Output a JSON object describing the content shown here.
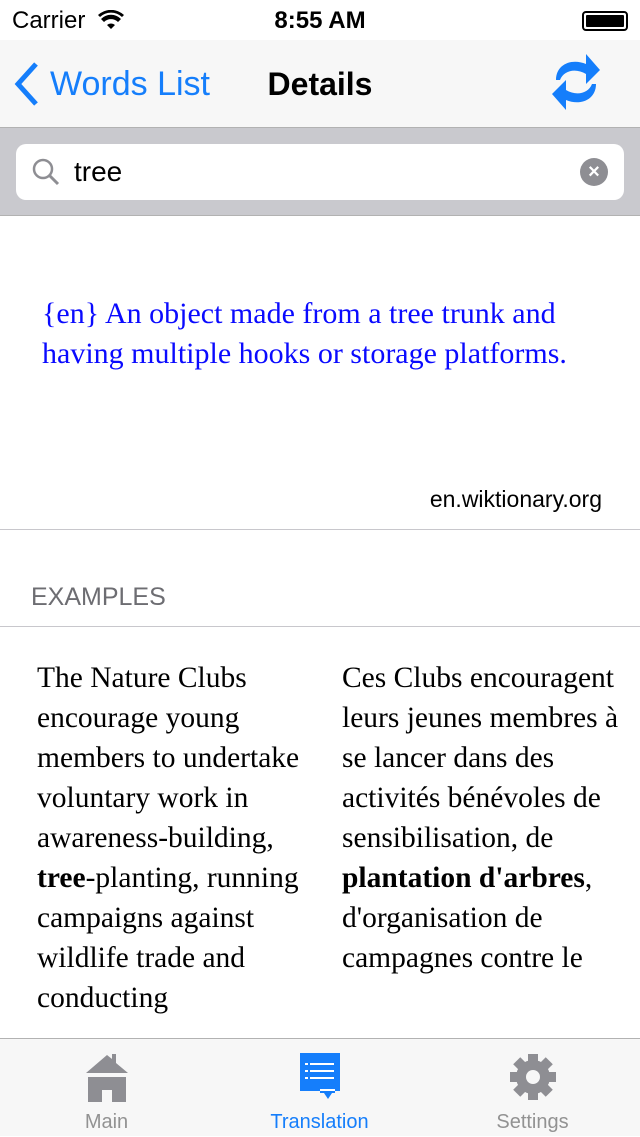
{
  "status_bar": {
    "carrier": "Carrier",
    "time": "8:55 AM"
  },
  "nav": {
    "back_label": "Words List",
    "title": "Details",
    "refresh_icon": "refresh-icon"
  },
  "search": {
    "value": "tree",
    "placeholder": ""
  },
  "definition": {
    "text": "{en} An object made from a tree trunk and having multiple hooks or storage platforms.",
    "source": "en.wiktionary.org"
  },
  "examples": {
    "header": "EXAMPLES",
    "source_before": "The Nature Clubs encourage young members to undertake voluntary work in awareness-building, ",
    "source_bold": "tree",
    "source_after": "-planting, running campaigns against wildlife trade and conducting",
    "target_before": "Ces Clubs encouragent leurs jeunes membres à se lancer dans des activités bénévoles de sensibilisation, de ",
    "target_bold": "plantation d'arbres",
    "target_after": ", d'organisation de campagnes contre le"
  },
  "tabs": [
    {
      "label": "Main",
      "icon": "home-icon"
    },
    {
      "label": "Translation",
      "icon": "translation-icon",
      "active": true
    },
    {
      "label": "Settings",
      "icon": "gear-icon"
    }
  ],
  "colors": {
    "accent": "#157efb",
    "definition": "#0a0aff"
  }
}
